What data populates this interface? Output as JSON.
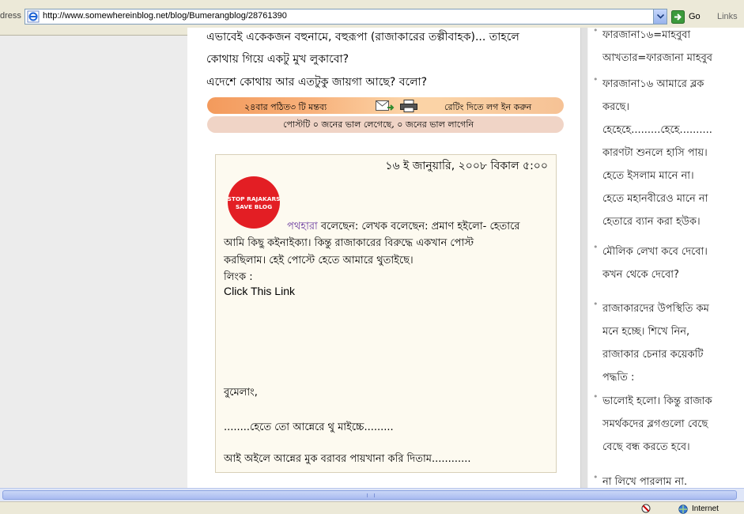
{
  "browser": {
    "address_label": "dress",
    "url": "http://www.somewhereinblog.net/blog/Bumerangblog/28761390",
    "go_label": "Go",
    "links_label": "Links",
    "status_zone": "Internet"
  },
  "post": {
    "lines": [
      "এভাবেই একেকজন বহুনামে, বহুরূপা (রাজাকারের তল্পীবাহক)... তাহলে",
      "কোথায় গিয়ে একটু মুখ লুকাবো?",
      "এদেশে কোথায় আর এতটুকু জায়গা আছে? বলো?"
    ]
  },
  "post_bar": {
    "stats": "২৪বার পঠিত৩ টি মন্তব্য",
    "rating_login": "রেটিং দিতে লগ ইন করুন",
    "likes": "পোস্টটি ০ জনের ভাল লেগেছে, ০ জনের ভাল লাগেনি"
  },
  "comment": {
    "date": "১৬ ই জানুয়ারি, ২০০৮ বিকাল ৫:০০",
    "badge_line1": "STOP RAJAKARS",
    "badge_line2": "SAVE BLOG",
    "badge_color": "#e31e24",
    "author": "পথহারা",
    "line1_rest": " বলেছেন: লেখক বলেছেন: প্রমাণ হইলো- হেতারে",
    "line2": "আমি কিছু কইনাইক্যা। কিন্তু রাজাকারের বিরুদ্ধে একখান পোস্ট",
    "line3": "করছিলাম। হেই পোস্টে হেতে আমারে থুতাইছে।",
    "line4": "লিংক :",
    "link_text": "Click This Link",
    "line5": "বুমেলাং,",
    "line6": "........হেতে তো আন্নেরে থু মাইচ্চে.........",
    "line7": "আই অইলে আন্নের মুক বরাবর পায়খানা করি দিতাম............"
  },
  "recent_comments": [
    {
      "lines": [
        "ফারজানা১৬=মাহবুবা",
        "আখতার=ফারজানা মাহবুব"
      ]
    },
    {
      "lines": [
        "ফারজানা১৬ আমারে ব্লক",
        "করছে।",
        "হেহেহে.........হেহে..........",
        "কারণটা শুনলে হাসি পায়।",
        "হেতে ইসলাম মানে না।",
        "হেতে মহানবীরেও মানে না",
        "হেতারে ব্যান করা হউক।"
      ]
    },
    {
      "lines": [
        "মৌলিক লেখা কবে দেবো।",
        "কখন থেকে দেবো?"
      ]
    },
    {
      "lines": [
        "রাজাকারদের উপস্থিতি কম",
        "মনে হচ্ছে। শিখে নিন,",
        "রাজাকার চেনার কয়েকটি",
        "পদ্ধতি :"
      ]
    },
    {
      "lines": [
        "ভালোই হলো। কিন্তু রাজাক",
        "সমর্থকদের ব্লগগুলো বেছে",
        "বেছে বন্ধ করতে হবে।"
      ]
    },
    {
      "lines": [
        "না লিখে পারলাম না."
      ]
    }
  ]
}
